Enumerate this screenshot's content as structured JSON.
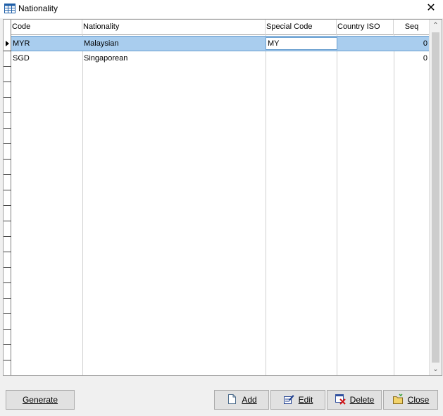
{
  "window": {
    "title": "Nationality",
    "close_glyph": "✕",
    "icons": {
      "title": "table-icon"
    }
  },
  "grid": {
    "columns": [
      "Code",
      "Nationality",
      "Special Code",
      "Country ISO",
      "Seq"
    ],
    "rows": [
      {
        "code": "MYR",
        "nationality": "Malaysian",
        "special_code": "MY",
        "country_iso": "",
        "seq": "0"
      },
      {
        "code": "SGD",
        "nationality": "Singaporean",
        "special_code": "",
        "country_iso": "",
        "seq": "0"
      }
    ],
    "selected_row_color": "#a9cdee",
    "scroll_up_glyph": "⌃",
    "scroll_down_glyph": "⌄"
  },
  "buttons": {
    "generate": "Generate",
    "add": "Add",
    "edit": "Edit",
    "delete": "Delete",
    "close": "Close"
  },
  "icons": {
    "add": "new-document-icon",
    "edit": "edit-pencil-icon",
    "delete": "delete-icon",
    "close": "folder-close-icon"
  }
}
